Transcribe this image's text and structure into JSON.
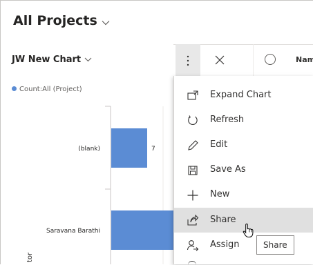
{
  "header": {
    "view_title": "All Projects"
  },
  "chart": {
    "title": "JW New Chart",
    "legend": "Count:All (Project)",
    "y_axis_label_partial": "tor"
  },
  "chart_data": {
    "type": "bar",
    "title": "JW New Chart",
    "legend": [
      "Count:All (Project)"
    ],
    "categories": [
      "(blank)",
      "Saravana Barathi"
    ],
    "values": [
      7,
      null
    ],
    "ylabel": "tor",
    "orientation": "horizontal",
    "series": [
      {
        "name": "Count:All (Project)",
        "values": [
          7,
          null
        ]
      }
    ]
  },
  "grid_header": {
    "column_name": "Nam"
  },
  "menu": {
    "items": [
      {
        "label": "Expand Chart",
        "icon": "expand-icon"
      },
      {
        "label": "Refresh",
        "icon": "refresh-icon"
      },
      {
        "label": "Edit",
        "icon": "pencil-icon"
      },
      {
        "label": "Save As",
        "icon": "save-icon"
      },
      {
        "label": "New",
        "icon": "plus-icon"
      },
      {
        "label": "Share",
        "icon": "share-icon"
      },
      {
        "label": "Assign",
        "icon": "assign-icon"
      }
    ]
  },
  "tooltip": {
    "text": "Share"
  },
  "colors": {
    "bar": "#5b8cd4",
    "menu_hover": "#e0e0e0",
    "button_bg": "#e8e8e8"
  }
}
